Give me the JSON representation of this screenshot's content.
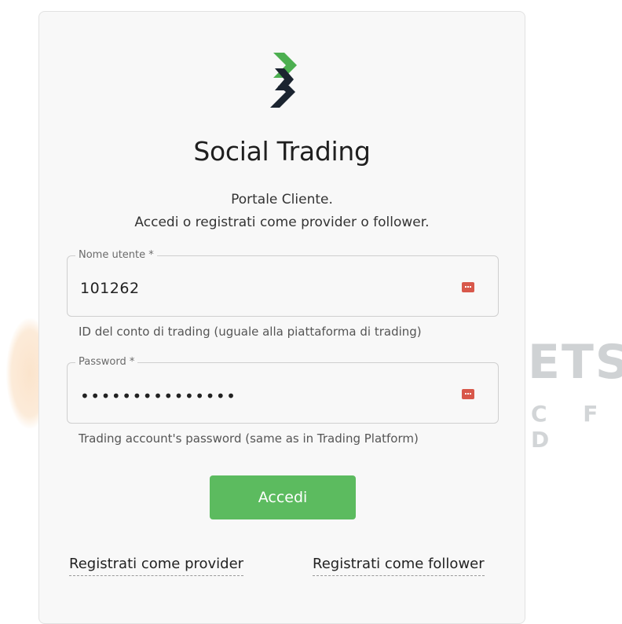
{
  "colors": {
    "accent_green": "#5cbb5f",
    "logo_green": "#4caf50",
    "logo_dark": "#1b2430",
    "key_icon": "#d8584b"
  },
  "header": {
    "title": "Social Trading",
    "subtitle_line1": "Portale Cliente.",
    "subtitle_line2": "Accedi o registrati come provider o follower."
  },
  "form": {
    "username": {
      "label": "Nome utente *",
      "value": "101262",
      "helper": "ID del conto di trading (uguale alla piattaforma di trading)",
      "icon": "password-manager-key-icon"
    },
    "password": {
      "label": "Password *",
      "value_masked": "•••••••••••••••",
      "helper": "Trading account's password (same as in Trading Platform)",
      "icon": "password-manager-key-icon"
    },
    "submit_label": "Accedi"
  },
  "links": {
    "register_provider": "Registrati come provider",
    "register_follower": "Registrati come follower"
  },
  "background": {
    "brand_partial": "ETS",
    "brand_sub_partial": "C F D"
  }
}
